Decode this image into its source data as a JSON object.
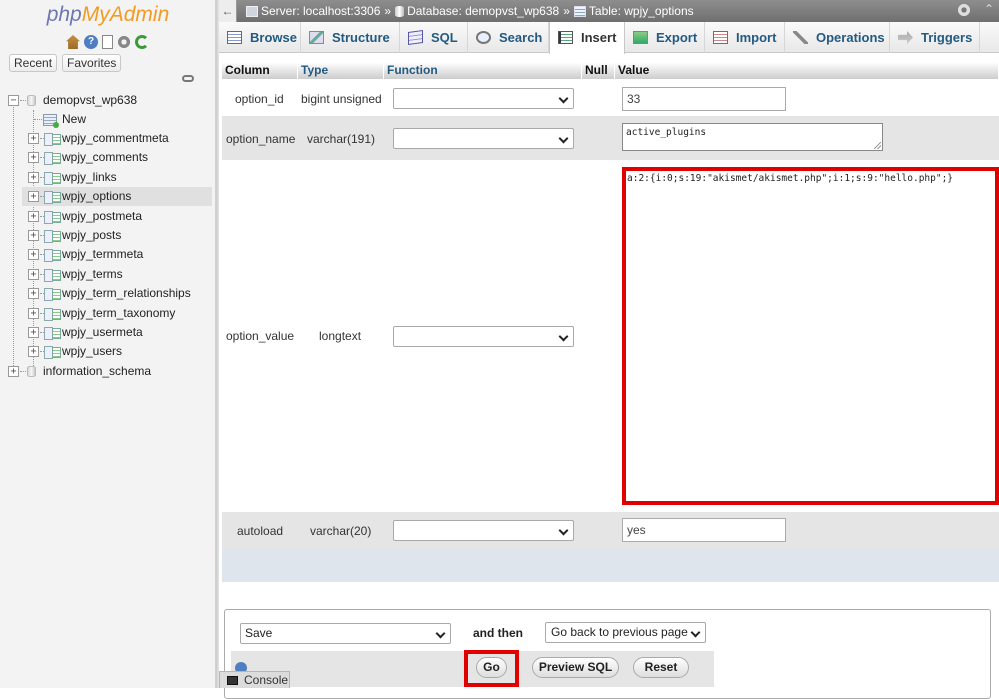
{
  "app": {
    "logo_php": "php",
    "logo_myadmin": "MyAdmin",
    "nav_tabs": [
      "Recent",
      "Favorites"
    ]
  },
  "nav_icons": [
    "home-icon",
    "help-icon",
    "docs-icon",
    "settings-icon",
    "reload-icon"
  ],
  "tree": {
    "database": "demopvst_wp638",
    "new_label": "New",
    "tables": [
      "wpjy_commentmeta",
      "wpjy_comments",
      "wpjy_links",
      "wpjy_options",
      "wpjy_postmeta",
      "wpjy_posts",
      "wpjy_termmeta",
      "wpjy_terms",
      "wpjy_term_relationships",
      "wpjy_term_taxonomy",
      "wpjy_usermeta",
      "wpjy_users"
    ],
    "selected_table": "wpjy_options",
    "other_database": "information_schema"
  },
  "breadcrumb": {
    "back": "←",
    "server": "Server: localhost:3306",
    "database": "Database: demopvst_wp638",
    "table": "Table: wpjy_options",
    "separator": "»"
  },
  "tabs": [
    "Browse",
    "Structure",
    "SQL",
    "Search",
    "Insert",
    "Export",
    "Import",
    "Operations",
    "Triggers"
  ],
  "active_tab": "Insert",
  "grid": {
    "headers": {
      "column": "Column",
      "type": "Type",
      "function": "Function",
      "null": "Null",
      "value": "Value"
    },
    "rows": [
      {
        "column": "option_id",
        "type": "bigint unsigned",
        "function": "",
        "value": "33"
      },
      {
        "column": "option_name",
        "type": "varchar(191)",
        "function": "",
        "value": "active_plugins"
      },
      {
        "column": "option_value",
        "type": "longtext",
        "function": "",
        "value": "a:2:{i:0;s:19:\"akismet/akismet.php\";i:1;s:9:\"hello.php\";}"
      },
      {
        "column": "autoload",
        "type": "varchar(20)",
        "function": "",
        "value": "yes"
      }
    ]
  },
  "actions": {
    "save_select": "Save",
    "and_then": "and then",
    "after_select": "Go back to previous page",
    "go": "Go",
    "preview_sql": "Preview SQL",
    "reset": "Reset"
  },
  "console": {
    "label": "Console"
  },
  "colors": {
    "link_blue": "#235a81",
    "highlight_red": "#e00000",
    "logo_blue": "#6c78af",
    "logo_orange": "#f29b23"
  }
}
